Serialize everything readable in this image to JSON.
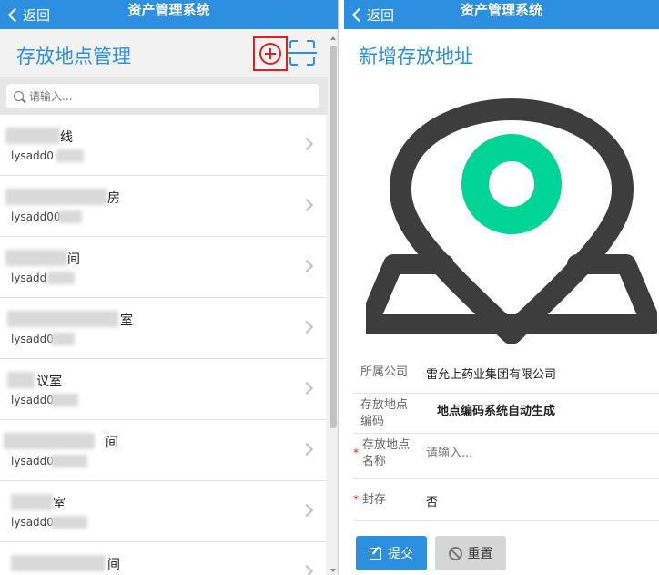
{
  "left": {
    "topbar": {
      "back_label": "返回",
      "title": "资产管理系统"
    },
    "page_title": "存放地点管理",
    "search": {
      "placeholder": "请输入..."
    },
    "items": [
      {
        "name_visible": "线",
        "code_visible": "lysadd0"
      },
      {
        "name_visible": "房",
        "code_visible": "lysadd00"
      },
      {
        "name_visible": "间",
        "code_visible": "lysadd"
      },
      {
        "name_visible": "室",
        "code_visible": "lysadd0"
      },
      {
        "name_visible": "议室",
        "code_visible": "lysadd0"
      },
      {
        "name_visible": "间",
        "code_visible": "lysadd0"
      },
      {
        "name_visible": "室",
        "code_visible": "lysadd0"
      },
      {
        "name_visible": "间",
        "code_visible": ""
      }
    ]
  },
  "right": {
    "topbar": {
      "back_label": "返回",
      "title": "资产管理系统"
    },
    "form_title": "新增存放地址",
    "fields": {
      "company": {
        "label": "所属公司",
        "value": "雷允上药业集团有限公司"
      },
      "code": {
        "label_line1": "存放地点",
        "label_line2": "编码",
        "value": "地点编码系统自动生成"
      },
      "name": {
        "label_line1": "存放地点",
        "label_line2": "名称",
        "placeholder": "请输入...",
        "required_mark": "*"
      },
      "sealed": {
        "label": "封存",
        "value": "否",
        "required_mark": "*"
      }
    },
    "buttons": {
      "submit": "提交",
      "reset": "重置"
    }
  },
  "colors": {
    "accent": "#2c8fe0",
    "highlight": "#e02020",
    "pin_outer": "#3d3d3d",
    "pin_inner": "#00d496"
  }
}
